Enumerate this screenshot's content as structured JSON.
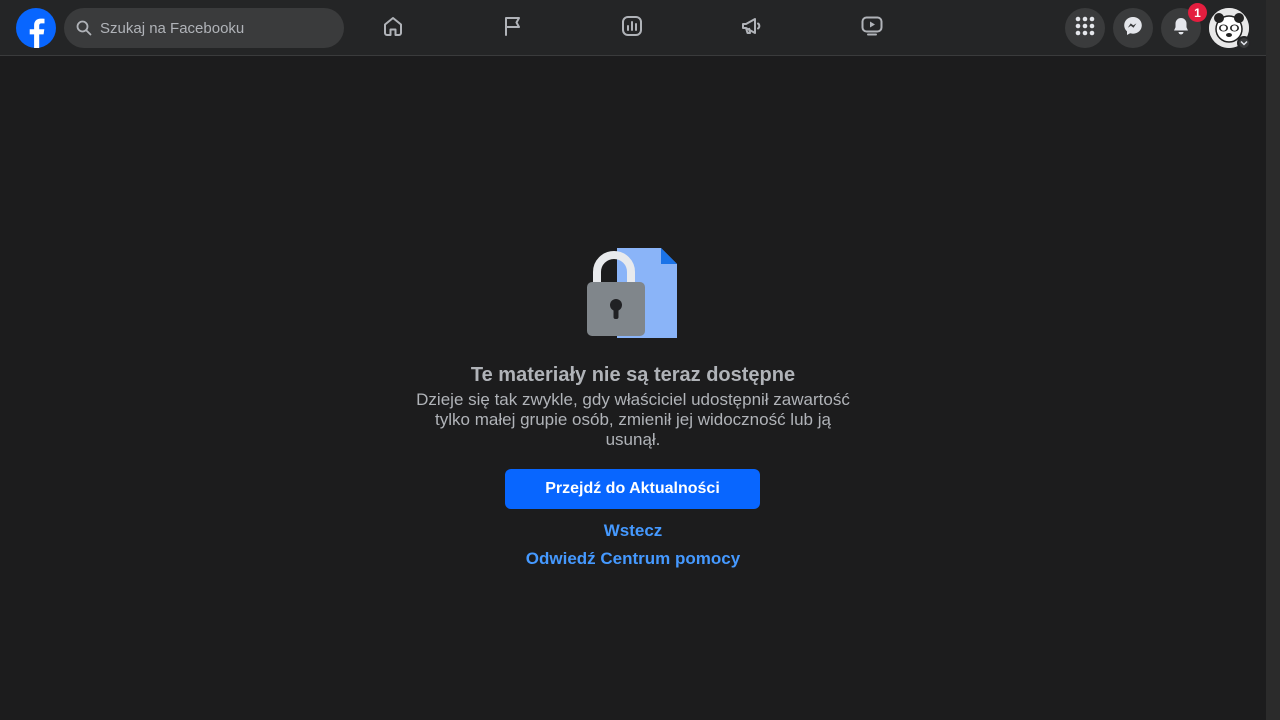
{
  "header": {
    "search": {
      "placeholder": "Szukaj na Facebooku",
      "icon": "search-icon"
    },
    "nav_tabs": [
      {
        "name": "home",
        "icon": "home-icon"
      },
      {
        "name": "pages",
        "icon": "flag-icon"
      },
      {
        "name": "ads-manager",
        "icon": "chart-icon"
      },
      {
        "name": "advertise",
        "icon": "megaphone-icon"
      },
      {
        "name": "watch",
        "icon": "video-icon"
      }
    ],
    "actions": {
      "menu_icon": "grid-menu-icon",
      "messenger_icon": "messenger-icon",
      "notifications_icon": "bell-icon",
      "notifications_count": "1"
    }
  },
  "main": {
    "illustration_icon": "locked-document-icon",
    "title": "Te materiały nie są teraz dostępne",
    "description": "Dzieje się tak zwykle, gdy właściciel udostępnił zawartość tylko małej grupie osób, zmienił jej widoczność lub ją usunął.",
    "primary_button": "Przejdź do Aktualności",
    "back_link": "Wstecz",
    "help_link": "Odwiedź Centrum pomocy"
  },
  "colors": {
    "background": "#1c1c1d",
    "header": "#242526",
    "accent": "#0866ff",
    "link": "#4599ff",
    "badge": "#e41e3f"
  }
}
